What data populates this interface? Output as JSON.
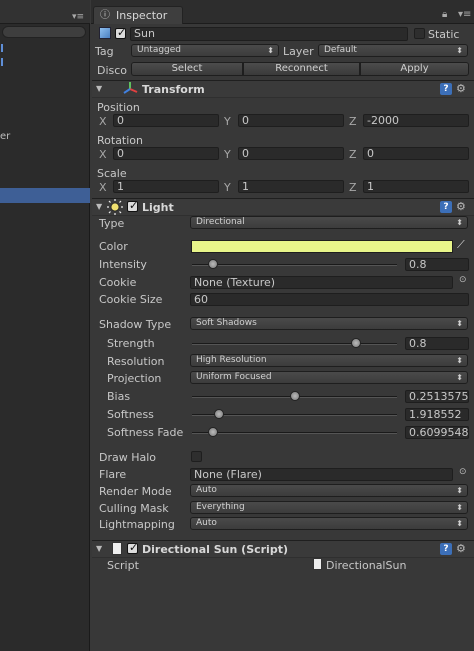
{
  "inspector": {
    "tab_label": "Inspector",
    "go_name": "Sun",
    "static_label": "Static",
    "tag_label": "Tag",
    "tag_value": "Untagged",
    "layer_label": "Layer",
    "layer_value": "Default",
    "prefab_label": "Disco",
    "prefab_select": "Select",
    "prefab_reconnect": "Reconnect",
    "prefab_apply": "Apply"
  },
  "transform": {
    "title": "Transform",
    "position_label": "Position",
    "rotation_label": "Rotation",
    "scale_label": "Scale",
    "x": "X",
    "y": "Y",
    "z": "Z",
    "position": [
      "0",
      "0",
      "-2000"
    ],
    "rotation": [
      "0",
      "0",
      "0"
    ],
    "scale": [
      "1",
      "1",
      "1"
    ]
  },
  "light": {
    "title": "Light",
    "type_label": "Type",
    "type_value": "Directional",
    "color_label": "Color",
    "color_value": "#e8f58a",
    "intensity_label": "Intensity",
    "intensity_value": "0.8",
    "intensity_fraction": 0.1,
    "cookie_label": "Cookie",
    "cookie_value": "None (Texture)",
    "cookie_size_label": "Cookie Size",
    "cookie_size_value": "60",
    "shadow_type_label": "Shadow Type",
    "shadow_type_value": "Soft Shadows",
    "strength_label": "Strength",
    "strength_value": "0.8",
    "strength_fraction": 0.8,
    "resolution_label": "Resolution",
    "resolution_value": "High Resolution",
    "projection_label": "Projection",
    "projection_value": "Uniform Focused",
    "bias_label": "Bias",
    "bias_value": "0.2513575",
    "bias_fraction": 0.5,
    "softness_label": "Softness",
    "softness_value": "1.918552",
    "softness_fraction": 0.13,
    "softness_fade_label": "Softness Fade",
    "softness_fade_value": "0.6099548",
    "softness_fade_fraction": 0.1,
    "draw_halo_label": "Draw Halo",
    "flare_label": "Flare",
    "flare_value": "None (Flare)",
    "render_mode_label": "Render Mode",
    "render_mode_value": "Auto",
    "culling_mask_label": "Culling Mask",
    "culling_mask_value": "Everything",
    "lightmapping_label": "Lightmapping",
    "lightmapping_value": "Auto"
  },
  "script": {
    "title": "Directional Sun (Script)",
    "script_label": "Script",
    "script_value": "DirectionalSun"
  },
  "left_panel": {
    "partial_text": "er"
  },
  "colors": {
    "selection": "#3e5f96",
    "panel_bg": "#383838",
    "light_color": "#e8f58a"
  }
}
